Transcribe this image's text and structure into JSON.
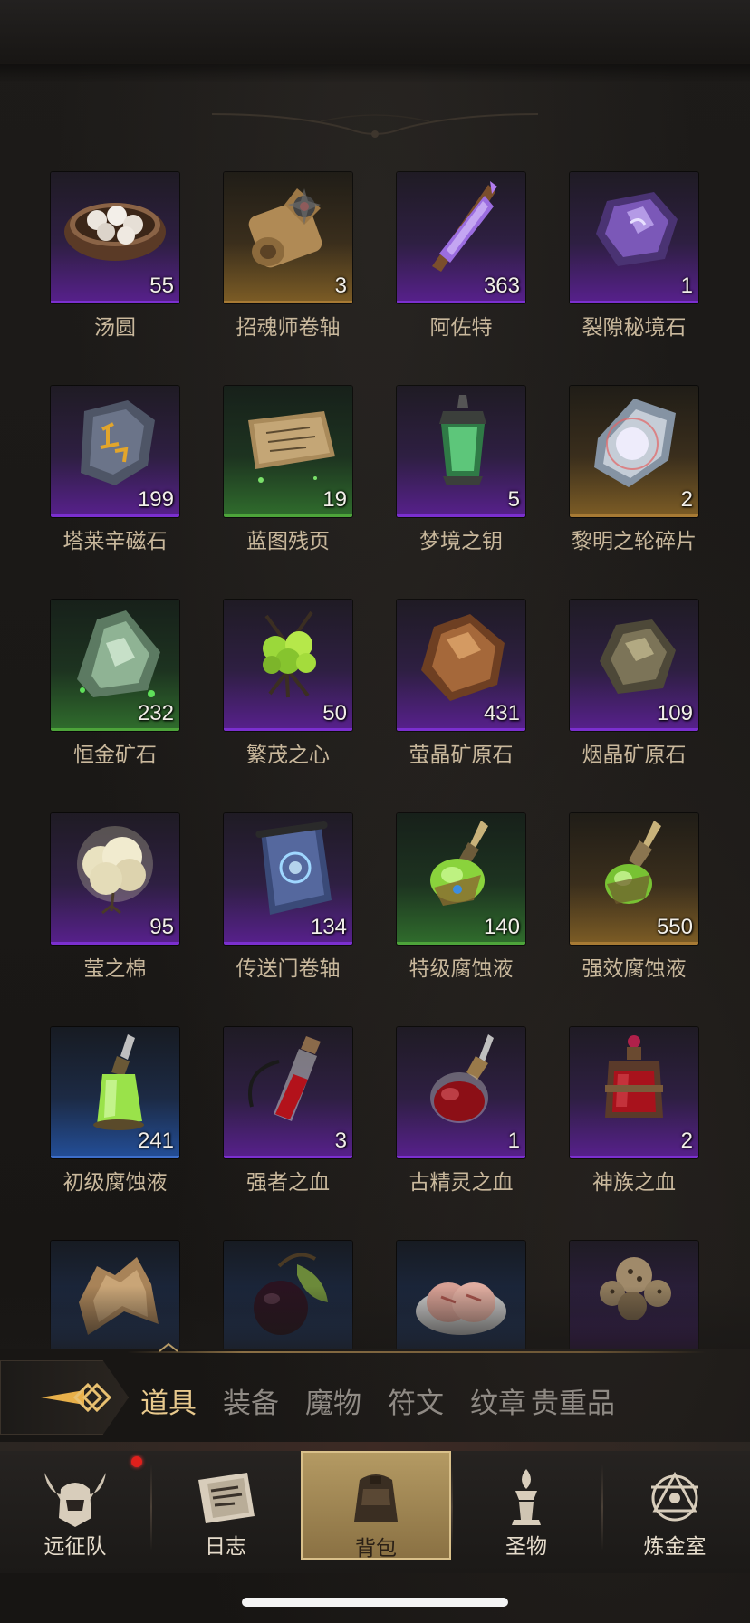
{
  "items": [
    {
      "name": "汤圆",
      "count": "55",
      "rarity": "purple",
      "icon": "tangyuan-bowl-icon"
    },
    {
      "name": "招魂师卷轴",
      "count": "3",
      "rarity": "gold",
      "icon": "scroll-icon"
    },
    {
      "name": "阿佐特",
      "count": "363",
      "rarity": "purple",
      "icon": "purple-crystal-icon"
    },
    {
      "name": "裂隙秘境石",
      "count": "1",
      "rarity": "purple",
      "icon": "amethyst-stone-icon"
    },
    {
      "name": "塔莱辛磁石",
      "count": "199",
      "rarity": "purple",
      "icon": "rune-rock-icon"
    },
    {
      "name": "蓝图残页",
      "count": "19",
      "rarity": "green",
      "icon": "blueprint-page-icon"
    },
    {
      "name": "梦境之钥",
      "count": "5",
      "rarity": "purple",
      "icon": "green-lantern-icon"
    },
    {
      "name": "黎明之轮碎片",
      "count": "2",
      "rarity": "gold",
      "icon": "shard-icon"
    },
    {
      "name": "恒金矿石",
      "count": "232",
      "rarity": "green",
      "icon": "green-ore-icon"
    },
    {
      "name": "繁茂之心",
      "count": "50",
      "rarity": "purple",
      "icon": "plant-heart-icon"
    },
    {
      "name": "萤晶矿原石",
      "count": "431",
      "rarity": "purple",
      "icon": "amber-ore-icon"
    },
    {
      "name": "烟晶矿原石",
      "count": "109",
      "rarity": "purple",
      "icon": "smoky-ore-icon"
    },
    {
      "name": "莹之棉",
      "count": "95",
      "rarity": "purple",
      "icon": "cotton-icon"
    },
    {
      "name": "传送门卷轴",
      "count": "134",
      "rarity": "purple",
      "icon": "portal-scroll-icon"
    },
    {
      "name": "特级腐蚀液",
      "count": "140",
      "rarity": "green",
      "icon": "green-potion-icon"
    },
    {
      "name": "强效腐蚀液",
      "count": "550",
      "rarity": "gold",
      "icon": "green-flask-icon"
    },
    {
      "name": "初级腐蚀液",
      "count": "241",
      "rarity": "blue",
      "icon": "small-green-potion-icon"
    },
    {
      "name": "强者之血",
      "count": "3",
      "rarity": "purple",
      "icon": "blood-vial-icon"
    },
    {
      "name": "古精灵之血",
      "count": "1",
      "rarity": "purple",
      "icon": "blood-flask-icon"
    },
    {
      "name": "神族之血",
      "count": "2",
      "rarity": "purple",
      "icon": "blood-jar-icon"
    },
    {
      "name": "",
      "count": "",
      "rarity": "blue",
      "icon": "leather-hide-icon"
    },
    {
      "name": "",
      "count": "",
      "rarity": "blue",
      "icon": "dark-fruit-icon"
    },
    {
      "name": "",
      "count": "",
      "rarity": "blue",
      "icon": "raw-meat-icon"
    },
    {
      "name": "",
      "count": "",
      "rarity": "purple",
      "icon": "mushroom-cluster-icon"
    }
  ],
  "tabs": [
    "道具",
    "装备",
    "魔物",
    "符文",
    "纹章",
    "贵重品"
  ],
  "active_tab": "道具",
  "nav": [
    {
      "label": "远征队",
      "icon": "horned-helmet-icon",
      "badge": true
    },
    {
      "label": "日志",
      "icon": "journal-icon"
    },
    {
      "label": "背包",
      "icon": "backpack-icon",
      "active": true
    },
    {
      "label": "圣物",
      "icon": "relic-icon"
    },
    {
      "label": "炼金室",
      "icon": "alchemy-icon"
    }
  ],
  "colors": {
    "accent": "#e8c98d",
    "purple": "#7b2fcf",
    "gold": "#a77a34",
    "green": "#4da43a",
    "blue": "#3d6ec9"
  }
}
